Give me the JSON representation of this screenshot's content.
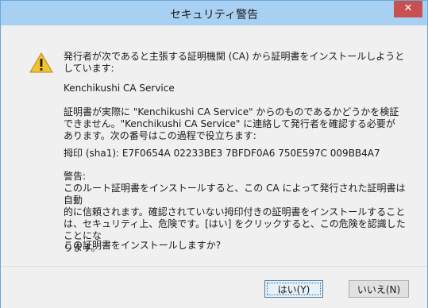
{
  "window": {
    "title": "セキュリティ警告",
    "close_label": "✕"
  },
  "message": {
    "intro": "発行者が次であると主張する証明機関 (CA) から証明書をインストールしようと\nしています:",
    "issuer": "Kenchikushi CA Service",
    "verify": "証明書が実際に \"Kenchikushi CA Service\" からのものであるかどうかを検証\nできません。\"Kenchikushi CA Service\" に連絡して発行者を確認する必要が\nあります。次の番号はこの過程で役立ちます:",
    "thumbprint": "拇印 (sha1): E7F0654A 02233BE3 7BFDF0A6 750E597C 009BB4A7",
    "warning": "警告:\nこのルート証明書をインストールすると、この CA によって発行された証明書は自動\n的に信頼されます。確認されていない拇印付きの証明書をインストールすること\nは、セキュリティ上、危険です。[はい] をクリックすると、この危険を認識したことにな\nります。",
    "question": "この証明書をインストールしますか?"
  },
  "buttons": {
    "yes": "はい(Y)",
    "no": "いいえ(N)"
  },
  "icons": {
    "warning": "warning-triangle-icon",
    "close": "close-icon"
  }
}
